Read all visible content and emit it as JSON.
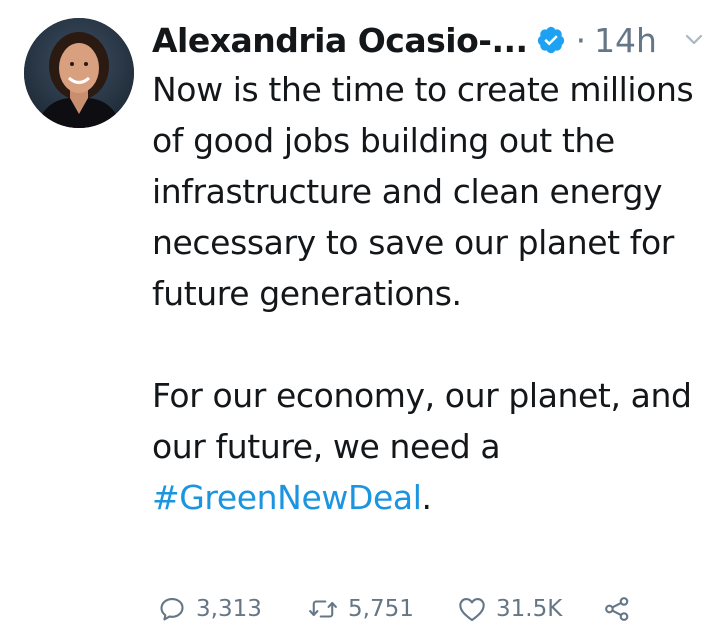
{
  "author": {
    "display_name": "Alexandria Ocasio-...",
    "verified_icon": "verified-badge-icon",
    "timestamp_separator": "·",
    "timestamp": "14h"
  },
  "tweet": {
    "paragraph_1": "Now is the time to create millions of good jobs building out the infrastructure and clean energy necessary to save our planet for future generations.",
    "paragraph_2_text": "For our economy, our planet, and our future, we need a ",
    "hashtag": "#GreenNewDeal",
    "paragraph_2_end": "."
  },
  "actions": {
    "reply_count": "3,313",
    "retweet_count": "5,751",
    "like_count": "31.5K"
  },
  "colors": {
    "text": "#14171a",
    "secondary": "#657786",
    "link": "#1b95e0",
    "verified": "#1da1f2"
  }
}
